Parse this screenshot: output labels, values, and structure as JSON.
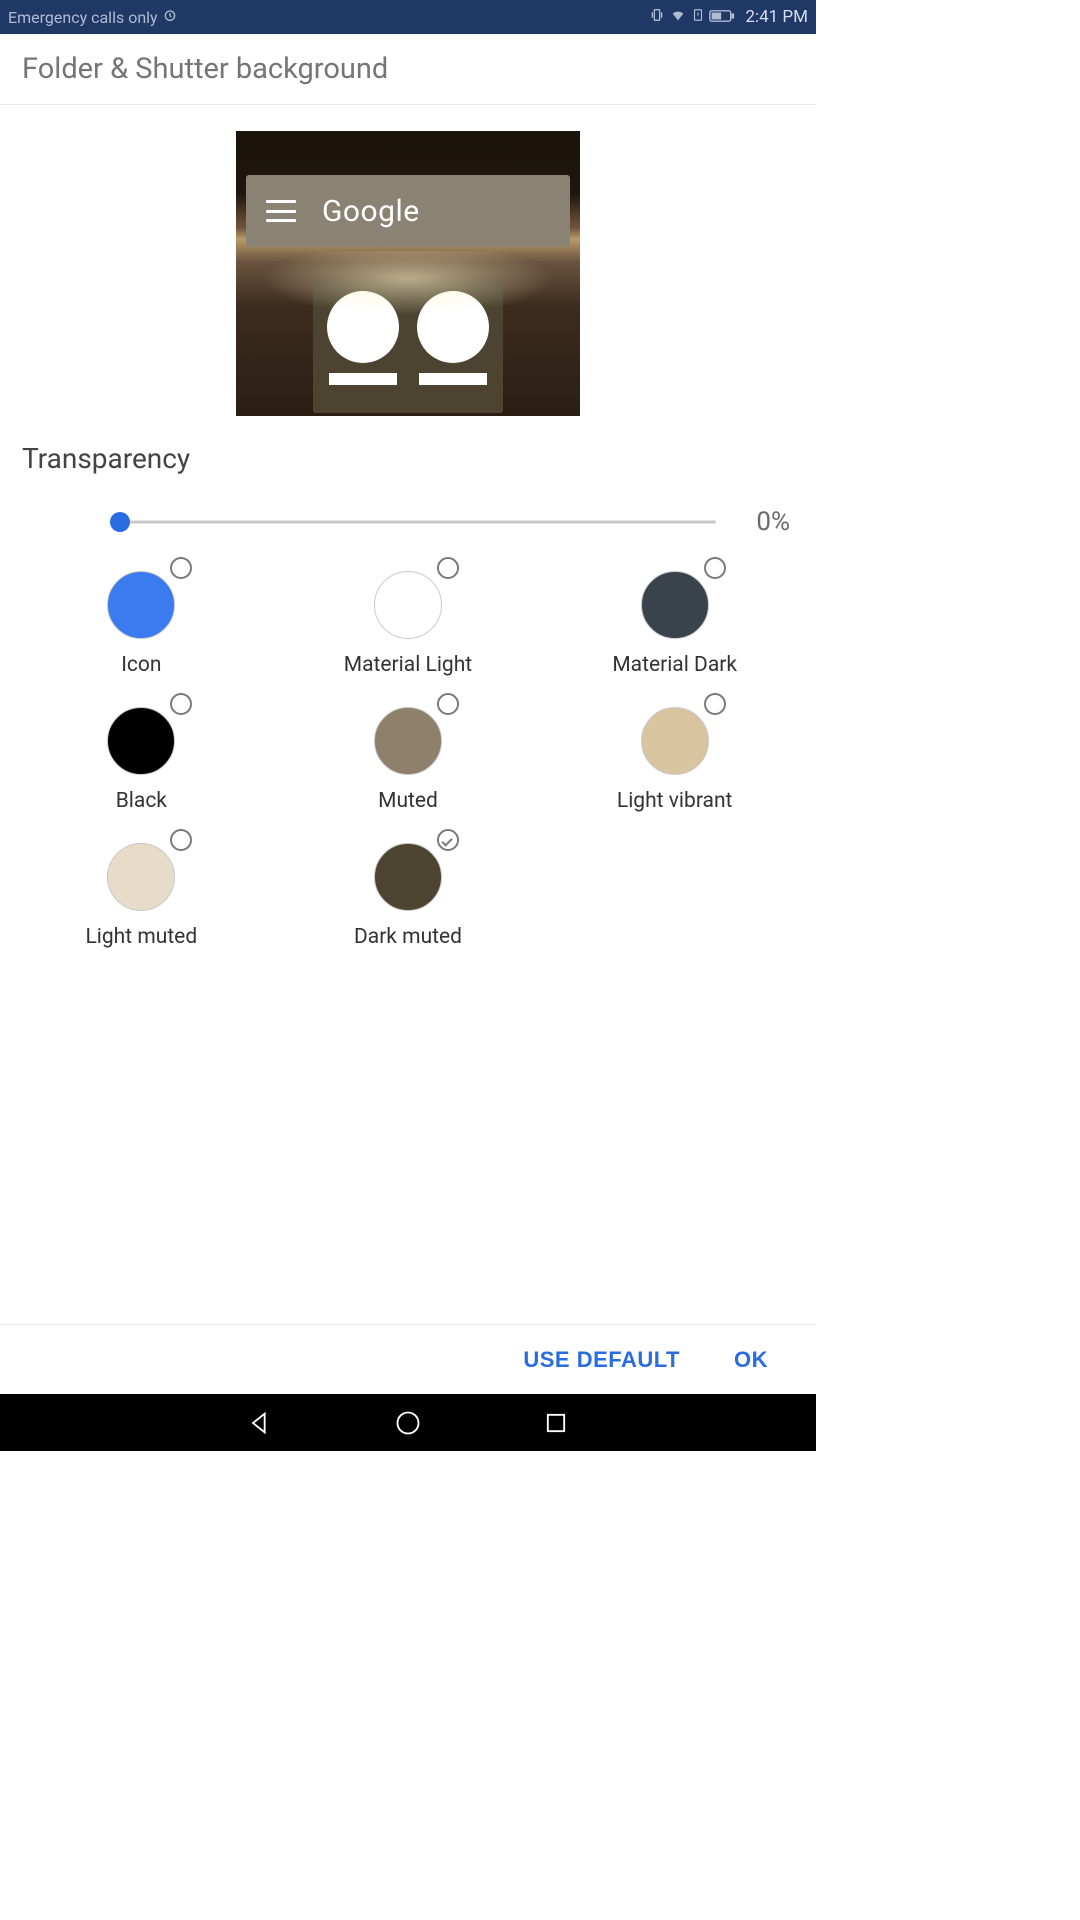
{
  "status": {
    "network_text": "Emergency calls only",
    "time": "2:41 PM"
  },
  "header": {
    "title": "Folder & Shutter background"
  },
  "preview": {
    "search_text": "Google"
  },
  "transparency": {
    "label": "Transparency",
    "value_pct": "0%"
  },
  "colors": [
    {
      "id": "icon",
      "label": "Icon",
      "hex": "#3a7bf0",
      "selected": false
    },
    {
      "id": "material-light",
      "label": "Material Light",
      "hex": "#ffffff",
      "selected": false
    },
    {
      "id": "material-dark",
      "label": "Material Dark",
      "hex": "#3a434c",
      "selected": false
    },
    {
      "id": "black",
      "label": "Black",
      "hex": "#000000",
      "selected": false
    },
    {
      "id": "muted",
      "label": "Muted",
      "hex": "#8f806c",
      "selected": false
    },
    {
      "id": "light-vibrant",
      "label": "Light vibrant",
      "hex": "#d9c4a0",
      "selected": false
    },
    {
      "id": "light-muted",
      "label": "Light muted",
      "hex": "#e6dcc7",
      "selected": false
    },
    {
      "id": "dark-muted",
      "label": "Dark muted",
      "hex": "#4c4430",
      "selected": true
    }
  ],
  "footer": {
    "use_default": "USE DEFAULT",
    "ok": "OK"
  }
}
